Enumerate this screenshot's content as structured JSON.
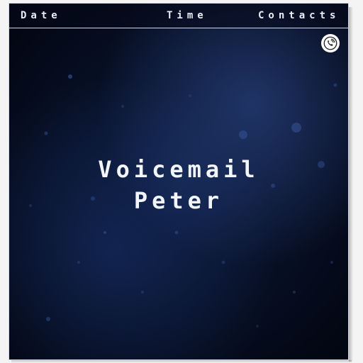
{
  "header": {
    "tabs": [
      {
        "label": "Date"
      },
      {
        "label": "Time"
      },
      {
        "label": "Contacts"
      }
    ]
  },
  "main": {
    "title": "Voicemail",
    "subtitle": "Peter",
    "call_icon": "phone-call-icon"
  },
  "colors": {
    "background_dark": "#050b1c",
    "background_glow": "#3c5fb4",
    "text": "#f2f5fb",
    "border": "#cfd6e6"
  }
}
